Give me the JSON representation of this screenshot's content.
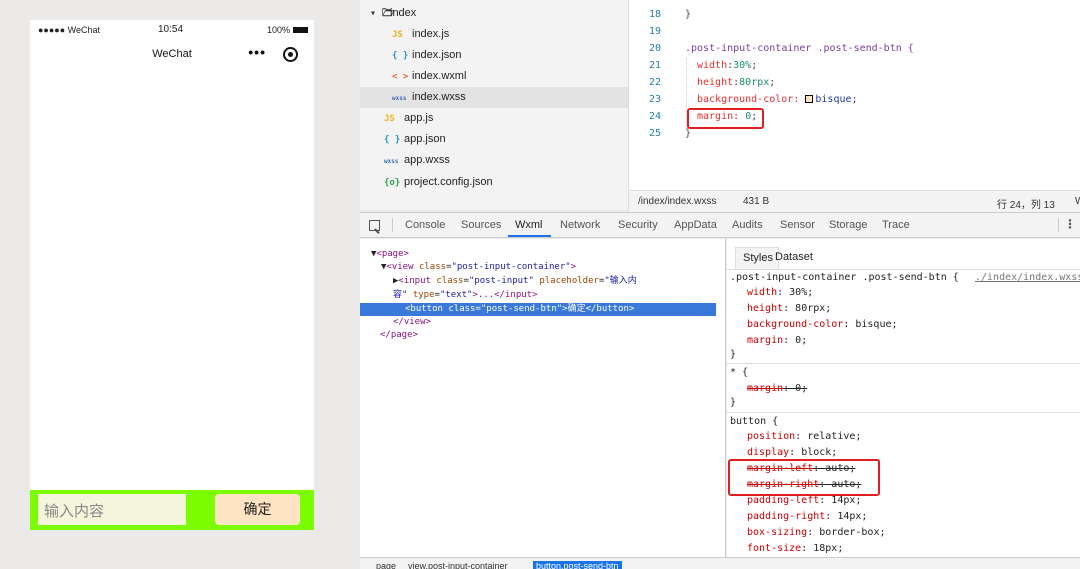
{
  "simulator": {
    "signal": "●●●●● WeChat",
    "time": "10:54",
    "battery": "100%",
    "nav_title": "WeChat",
    "menu": "•••",
    "input_placeholder": "输入内容",
    "send_label": "确定",
    "colors": {
      "bar": "#7cfc00",
      "input": "#f5f5dc",
      "button": "#ffe4c4"
    }
  },
  "filetree": {
    "folder": "index",
    "files": [
      {
        "icon": "JS",
        "name": "index.js"
      },
      {
        "icon": "{ }",
        "name": "index.json"
      },
      {
        "icon": "< >",
        "name": "index.wxml"
      },
      {
        "icon": "wxss",
        "name": "index.wxss"
      },
      {
        "icon": "JS",
        "name": "app.js"
      },
      {
        "icon": "{ }",
        "name": "app.json"
      },
      {
        "icon": "wxss",
        "name": "app.wxss"
      },
      {
        "icon": "{o}",
        "name": "project.config.json"
      }
    ]
  },
  "editor": {
    "lines": [
      "18",
      "19",
      "20",
      "21",
      "22",
      "23",
      "24",
      "25"
    ],
    "line18": "}",
    "selector": ".post-input-container .post-send-btn {",
    "width_prop": "width",
    "width_val": "30%",
    "height_prop": "height",
    "height_val": "80rpx",
    "bg_prop": "background-color:",
    "bg_val": "bisque",
    "margin_prop": "margin:",
    "margin_val": "0",
    "close": "}",
    "status_path": "/index/index.wxss",
    "status_size": "431 B",
    "status_pos": "行 24，列 13",
    "status_extra": "W"
  },
  "devtools": {
    "tabs": [
      "Console",
      "Sources",
      "Wxml",
      "Network",
      "Security",
      "AppData",
      "Audits",
      "Sensor",
      "Storage",
      "Trace"
    ],
    "active_tab": "Wxml"
  },
  "wxml_tree": {
    "page_open": "<page>",
    "view_open": "<view",
    "view_attr": "class",
    "view_class": "\"post-input-container\"",
    "input_open": "<input",
    "input_attr1": "class",
    "input_class": "\"post-input\"",
    "input_attr2": "placeholder",
    "input_ph1": "\"输入内",
    "input_ph2": "容\"",
    "input_attr3": "type",
    "input_type": "\"text\"",
    "input_rest": ">...</input>",
    "button_open": "<button",
    "button_attr": "class",
    "button_class": "\"post-send-btn\"",
    "button_text": "确定",
    "button_close": "</button>",
    "view_close": "</view>",
    "page_close": "</page>"
  },
  "styles_pane": {
    "tab_styles": "Styles",
    "tab_dataset": "Dataset",
    "rule1_selector": ".post-input-container .post-send-btn {",
    "rule1_link": "./index/index.wxss",
    "rule1_decls": [
      {
        "prop": "width",
        "val": "30%;"
      },
      {
        "prop": "height",
        "val": "80rpx;"
      },
      {
        "prop": "background-color",
        "val": "bisque;"
      },
      {
        "prop": "margin",
        "val": "0;"
      }
    ],
    "rule2_selector": "* {",
    "rule2_prop": "margin",
    "rule2_val": "0;",
    "rule3_selector": "button {",
    "rule3_decls": [
      {
        "prop": "position",
        "val": "relative;"
      },
      {
        "prop": "display",
        "val": "block;"
      },
      {
        "prop": "margin-left",
        "val": "auto;"
      },
      {
        "prop": "margin-right",
        "val": "auto;"
      },
      {
        "prop": "padding-left",
        "val": "14px;"
      },
      {
        "prop": "padding-right",
        "val": "14px;"
      },
      {
        "prop": "box-sizing",
        "val": "border-box;"
      },
      {
        "prop": "font-size",
        "val": "18px;"
      }
    ],
    "close": "}"
  },
  "breadcrumb": {
    "items": [
      "page",
      "view.post-input-container",
      "button.post-send-btn"
    ]
  }
}
